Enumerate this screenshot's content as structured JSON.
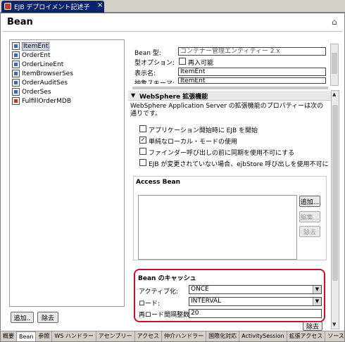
{
  "editor_tab": {
    "title": "EJB デプロイメント記述子",
    "close": "×"
  },
  "page": {
    "title": "Bean"
  },
  "beans": [
    {
      "name": "ItemEnt",
      "selected": true,
      "icon": "entity-bean-icon"
    },
    {
      "name": "OrderEnt",
      "icon": "entity-bean-icon"
    },
    {
      "name": "OrderLineEnt",
      "icon": "entity-bean-icon"
    },
    {
      "name": "ItemBrowserSes",
      "icon": "session-bean-icon"
    },
    {
      "name": "OrderAuditSes",
      "icon": "session-bean-icon"
    },
    {
      "name": "OrderSes",
      "icon": "session-bean-icon"
    },
    {
      "name": "FulfillOrderMDB",
      "icon": "message-bean-icon"
    }
  ],
  "left_buttons": {
    "add": "追加..",
    "remove": "除去"
  },
  "props": {
    "bean_type_label": "Bean 型:",
    "bean_type_value": "コンテナー管理エンティティー 2.x",
    "type_option_label": "型オプション:",
    "reentrant_label": "再入可能",
    "display_name_label": "表示名:",
    "display_name_value": "ItemEnt",
    "abstract_schema_label": "抽象スキーマ:",
    "abstract_schema_value": "ItemEnt"
  },
  "websphere": {
    "header": "WebSphere 拡張機能",
    "description": "WebSphere Application Server の拡張機能のプロパティーは次の通りです。",
    "options": [
      {
        "label": "アプリケーション開始時に EJB を開始",
        "checked": false
      },
      {
        "label": "単純なローカル・モードの使用",
        "checked": true
      },
      {
        "label": "ファインダー呼び出しの前に同期を使用不可にする",
        "checked": false
      },
      {
        "label": "EJB が変更されていない場合、ejbStore 呼び出しを使用不可に",
        "checked": false
      }
    ]
  },
  "access_bean": {
    "title": "Access Bean",
    "add": "追加...",
    "edit": "編集...",
    "remove": "除去"
  },
  "cache": {
    "title": "Bean のキャッシュ",
    "activate_label": "アクティブ化:",
    "activate_value": "ONCE",
    "load_label": "ロード:",
    "load_value": "INTERVAL",
    "reload_label": "再ロード間隔整数:",
    "reload_value": "20",
    "remove_button": "除去"
  },
  "bottom_tabs": [
    "概要",
    "Bean",
    "参照",
    "WS ハンドラー",
    "アセンブリー",
    "アクセス",
    "仲介ハンドラー",
    "国際化対応",
    "ActivitySession",
    "拡張アクセス",
    "ソース"
  ],
  "active_bottom_tab": "Bean",
  "colors": {
    "highlight_border": "#c0142c",
    "tab_active": "#0a246a"
  }
}
